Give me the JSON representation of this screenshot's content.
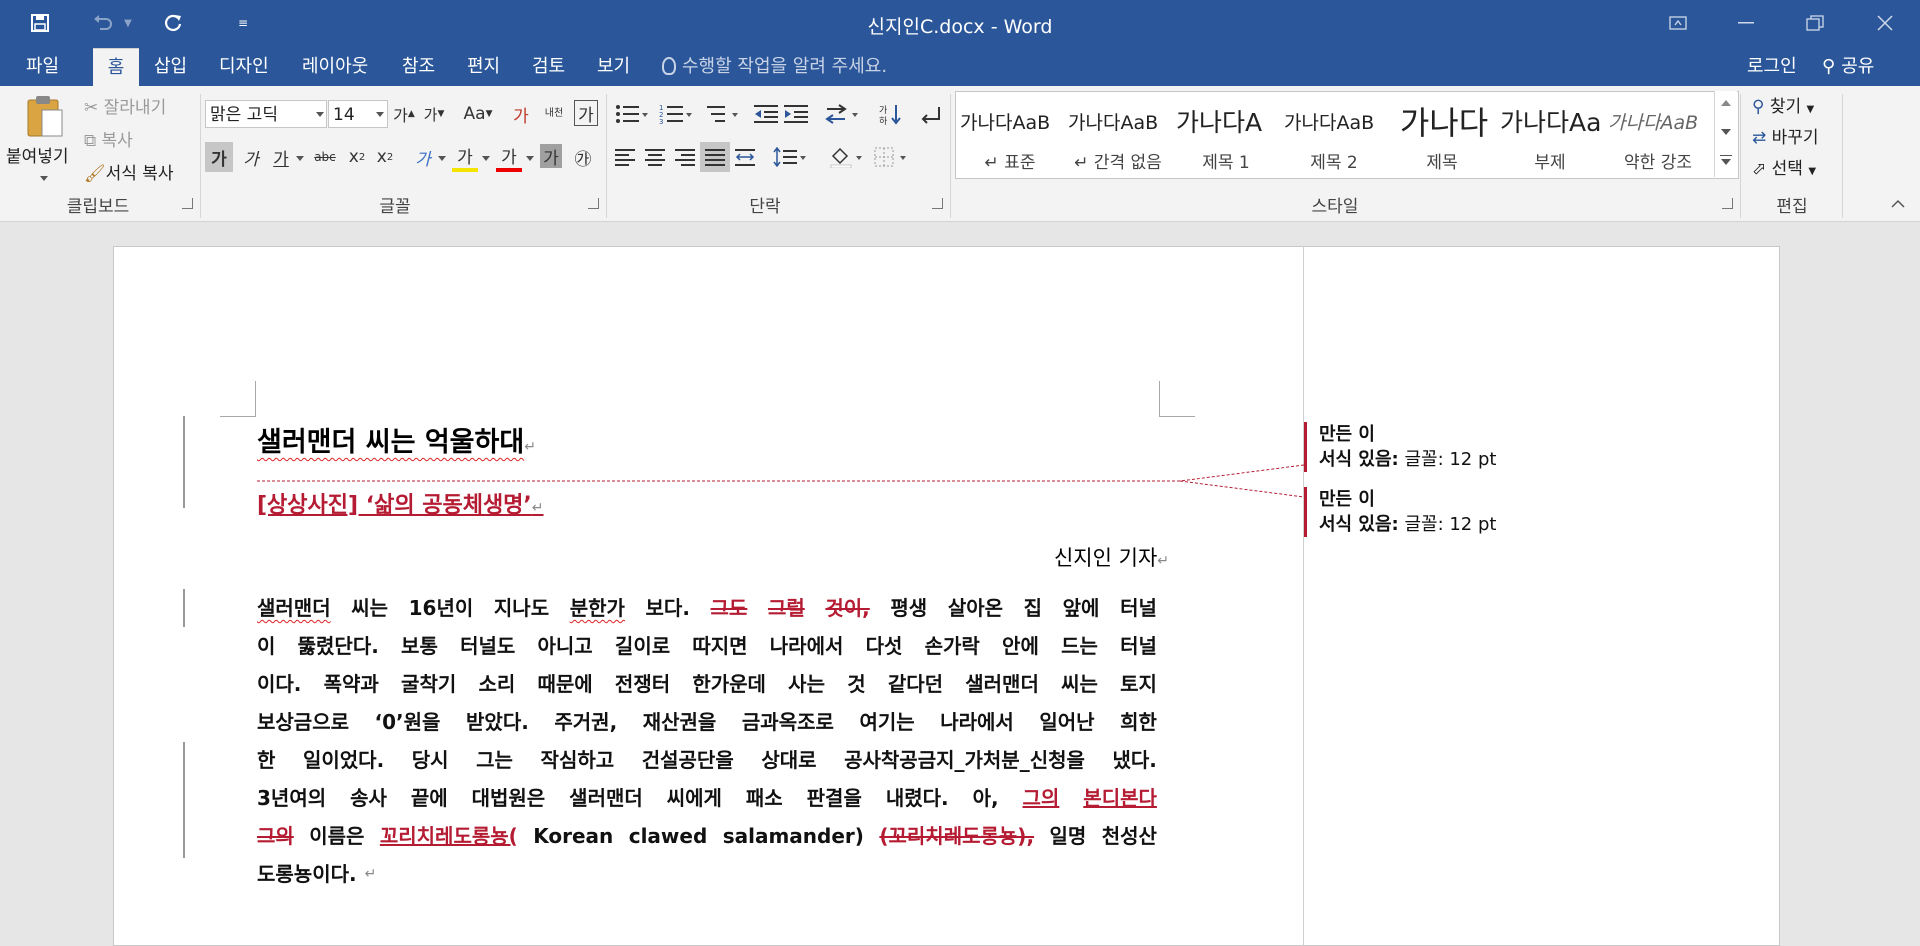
{
  "titlebar": {
    "title": "신지인C.docx - Word",
    "colors": {
      "brand": "#2b579a",
      "revision": "#b51c33"
    }
  },
  "menubar": {
    "tabs": [
      "파일",
      "홈",
      "삽입",
      "디자인",
      "레이아웃",
      "참조",
      "편지",
      "검토",
      "보기"
    ],
    "active_tab": "홈",
    "tell_me": "수행할 작업을 알려 주세요.",
    "login": "로그인",
    "share": "공유"
  },
  "ribbon": {
    "clipboard": {
      "label": "클립보드",
      "paste": "붙여넣기",
      "cut": "잘라내기",
      "copy": "복사",
      "format_painter": "서식 복사"
    },
    "font": {
      "label": "글꼴",
      "font_name": "맑은 고딕",
      "font_size": "14",
      "bold": "가",
      "italic": "가",
      "underline": "가",
      "strikethrough": "abc",
      "subscript": "x",
      "superscript": "x",
      "sub_mark": "2",
      "sup_mark": "2",
      "text_effects": "가",
      "highlight": "가",
      "font_color": "가",
      "char_shading": "가",
      "enclosed": "㉮",
      "grow": "가",
      "shrink": "가",
      "change_case": "Aa",
      "clear_format": "가",
      "phonetic": "내천",
      "char_border": "가"
    },
    "paragraph": {
      "label": "단락"
    },
    "styles": {
      "label": "스타일",
      "items": [
        {
          "preview": "가나다AaB",
          "name": "↵ 표준"
        },
        {
          "preview": "가나다AaB",
          "name": "↵ 간격 없음"
        },
        {
          "preview": "가나다A",
          "name": "제목 1"
        },
        {
          "preview": "가나다AaB",
          "name": "제목 2"
        },
        {
          "preview": "가나다",
          "name": "제목"
        },
        {
          "preview": "가나다Aa",
          "name": "부제"
        },
        {
          "preview": "가나다AaB",
          "name": "약한 강조"
        }
      ]
    },
    "editing": {
      "label": "편집",
      "find": "찾기",
      "replace": "바꾸기",
      "select": "선택"
    }
  },
  "document": {
    "title": "샐러맨더 씨는 억울하대",
    "subtitle": "[상상사진] ‘삶의 공동체생명’",
    "byline": "신지인 기자",
    "paragraph": [
      [
        {
          "t": "샐러맨더",
          "s": "squig"
        },
        {
          "t": "씨는"
        },
        {
          "t": "16년이"
        },
        {
          "t": "지나도"
        },
        {
          "t": "분한가",
          "s": "squig"
        },
        {
          "t": "보다."
        },
        {
          "t": "그도",
          "s": "del"
        },
        {
          "t": "그럴",
          "s": "del"
        },
        {
          "t": "것이,",
          "s": "del"
        },
        {
          "t": "평생"
        },
        {
          "t": "살아온"
        },
        {
          "t": "집"
        },
        {
          "t": "앞에"
        },
        {
          "t": "터널"
        }
      ],
      [
        {
          "t": "이"
        },
        {
          "t": "뚫렸단다."
        },
        {
          "t": "보통"
        },
        {
          "t": "터널도"
        },
        {
          "t": "아니고"
        },
        {
          "t": "길이로"
        },
        {
          "t": "따지면"
        },
        {
          "t": "나라에서"
        },
        {
          "t": "다섯"
        },
        {
          "t": "손가락"
        },
        {
          "t": "안에"
        },
        {
          "t": "드는"
        },
        {
          "t": "터널"
        }
      ],
      [
        {
          "t": "이다."
        },
        {
          "t": "폭약과"
        },
        {
          "t": "굴착기"
        },
        {
          "t": "소리"
        },
        {
          "t": "때문에"
        },
        {
          "t": "전쟁터"
        },
        {
          "t": "한가운데"
        },
        {
          "t": "사는"
        },
        {
          "t": "것"
        },
        {
          "t": "같다던"
        },
        {
          "t": "샐러맨더"
        },
        {
          "t": "씨는"
        },
        {
          "t": "토지"
        }
      ],
      [
        {
          "t": "보상금으로"
        },
        {
          "t": "‘0’원을"
        },
        {
          "t": "받았다."
        },
        {
          "t": "주거권,"
        },
        {
          "t": "재산권을"
        },
        {
          "t": "금과옥조로"
        },
        {
          "t": "여기는"
        },
        {
          "t": "나라에서"
        },
        {
          "t": "일어난"
        },
        {
          "t": "희한"
        }
      ],
      [
        {
          "t": "한"
        },
        {
          "t": "일이었다."
        },
        {
          "t": "당시"
        },
        {
          "t": "그는"
        },
        {
          "t": "작심하고"
        },
        {
          "t": "건설공단을"
        },
        {
          "t": "상대로"
        },
        {
          "t": "공사착공금지_가처분_신청을"
        },
        {
          "t": "냈다."
        }
      ],
      [
        {
          "t": "3년여의"
        },
        {
          "t": "송사"
        },
        {
          "t": "끝에"
        },
        {
          "t": "대법원은"
        },
        {
          "t": "샐러맨더"
        },
        {
          "t": "씨에게"
        },
        {
          "t": "패소"
        },
        {
          "t": "판결을"
        },
        {
          "t": "내렸다."
        },
        {
          "t": "아,"
        },
        {
          "t": "그의",
          "s": "ins"
        },
        {
          "t": "본디본다",
          "s": "ins"
        }
      ],
      [
        {
          "t": "그의",
          "s": "del"
        },
        {
          "t": "이름은"
        },
        {
          "t": "꼬리치레도롱뇽(",
          "s": "ins"
        },
        {
          "t": "Korean"
        },
        {
          "t": "clawed"
        },
        {
          "t": "salamander)"
        },
        {
          "t": "(꼬리치레도롱뇽),",
          "s": "del"
        },
        {
          "t": "일명"
        },
        {
          "t": "천성산"
        }
      ],
      [
        {
          "t": "도롱뇽이다."
        }
      ]
    ]
  },
  "comments": [
    {
      "author": "만든 이",
      "label": "서식 있음:",
      "detail": "글꼴: 12 pt"
    },
    {
      "author": "만든 이",
      "label": "서식 있음:",
      "detail": "글꼴: 12 pt"
    }
  ]
}
